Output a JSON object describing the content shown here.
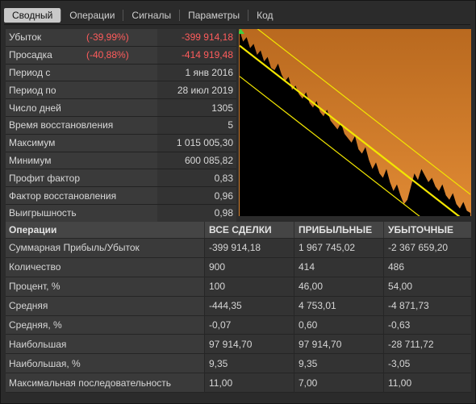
{
  "tabs": [
    "Сводный",
    "Операции",
    "Сигналы",
    "Параметры",
    "Код"
  ],
  "active_tab": 0,
  "stats": [
    {
      "label": "Убыток",
      "pct": "(-39,99%)",
      "value": "-399 914,18",
      "negative": true
    },
    {
      "label": "Просадка",
      "pct": "(-40,88%)",
      "value": "-414 919,48",
      "negative": true
    },
    {
      "label": "Период с",
      "pct": "",
      "value": "1 янв 2016",
      "negative": false
    },
    {
      "label": "Период по",
      "pct": "",
      "value": "28 июл 2019",
      "negative": false
    },
    {
      "label": "Число дней",
      "pct": "",
      "value": "1305",
      "negative": false
    },
    {
      "label": "Время восстановления",
      "pct": "",
      "value": "5",
      "negative": false
    },
    {
      "label": "Максимум",
      "pct": "",
      "value": "1 015 005,30",
      "negative": false
    },
    {
      "label": "Минимум",
      "pct": "",
      "value": "600 085,82",
      "negative": false
    },
    {
      "label": "Профит фактор",
      "pct": "",
      "value": "0,83",
      "negative": false
    },
    {
      "label": "Фактор восстановления",
      "pct": "",
      "value": "0,96",
      "negative": false
    },
    {
      "label": "Выигрышность",
      "pct": "",
      "value": "0,98",
      "negative": false
    }
  ],
  "table": {
    "headers": [
      "Операции",
      "ВСЕ СДЕЛКИ",
      "ПРИБЫЛЬНЫЕ",
      "УБЫТОЧНЫЕ"
    ],
    "rows": [
      [
        "Суммарная Прибыль/Убыток",
        "-399 914,18",
        "1 967 745,02",
        "-2 367 659,20"
      ],
      [
        "Количество",
        "900",
        "414",
        "486"
      ],
      [
        "Процент, %",
        "100",
        "46,00",
        "54,00"
      ],
      [
        "Средняя",
        "-444,35",
        "4 753,01",
        "-4 871,73"
      ],
      [
        "Средняя, %",
        "-0,07",
        "0,60",
        "-0,63"
      ],
      [
        "Наибольшая",
        "97 914,70",
        "97 914,70",
        "-28 711,72"
      ],
      [
        "Наибольшая, %",
        "9,35",
        "9,35",
        "-3,05"
      ],
      [
        "Максимальная последовательность",
        "11,00",
        "7,00",
        "11,00"
      ]
    ]
  },
  "colors": {
    "equity_fill": "#c8782a",
    "channel": "#f2e600",
    "negative": "#ff5c5c"
  },
  "chart_data": {
    "type": "area",
    "series": [
      {
        "values": [
          1015005,
          990000,
          1000000,
          975000,
          985000,
          960000,
          970000,
          945000,
          955000,
          930000,
          925000,
          940000,
          915000,
          900000,
          910000,
          880000,
          890000,
          870000,
          860000,
          875000,
          850000,
          840000,
          855000,
          830000,
          820000,
          835000,
          810000,
          800000,
          790000,
          805000,
          780000,
          770000,
          760000,
          775000,
          745000,
          735000,
          750000,
          720000,
          700000,
          715000,
          690000,
          680000,
          700000,
          670000,
          650000,
          665000,
          640000,
          620000,
          630000,
          660000,
          690000,
          675000,
          700000,
          685000,
          670000,
          680000,
          660000,
          650000,
          665000,
          640000,
          630000,
          645000,
          620000,
          610000,
          625000,
          605000,
          600086
        ]
      }
    ],
    "trend_channel": true
  }
}
